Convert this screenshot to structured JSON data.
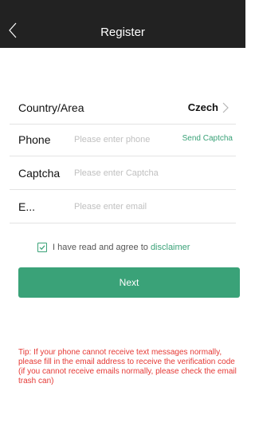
{
  "header": {
    "title": "Register",
    "back_icon": "chevron-left-icon"
  },
  "form": {
    "country": {
      "label": "Country/Area",
      "value": "Czech",
      "chevron_icon": "chevron-right-icon"
    },
    "phone": {
      "label": "Phone",
      "placeholder": "Please enter phone",
      "action_label": "Send Captcha"
    },
    "captcha": {
      "label": "Captcha",
      "placeholder": "Please enter Captcha"
    },
    "email": {
      "label": "E...",
      "placeholder": "Please enter email"
    }
  },
  "agreement": {
    "checked": true,
    "text": "I have read and agree to",
    "link_label": "disclaimer"
  },
  "next_button": {
    "label": "Next"
  },
  "tip": {
    "text": "Tip: If your phone cannot receive text messages normally, please fill in the email address to receive the verification code (if you cannot receive emails normally, please check the email trash can)"
  },
  "colors": {
    "accent": "#3aa278",
    "header_bg": "#222222",
    "tip": "#e53935"
  }
}
